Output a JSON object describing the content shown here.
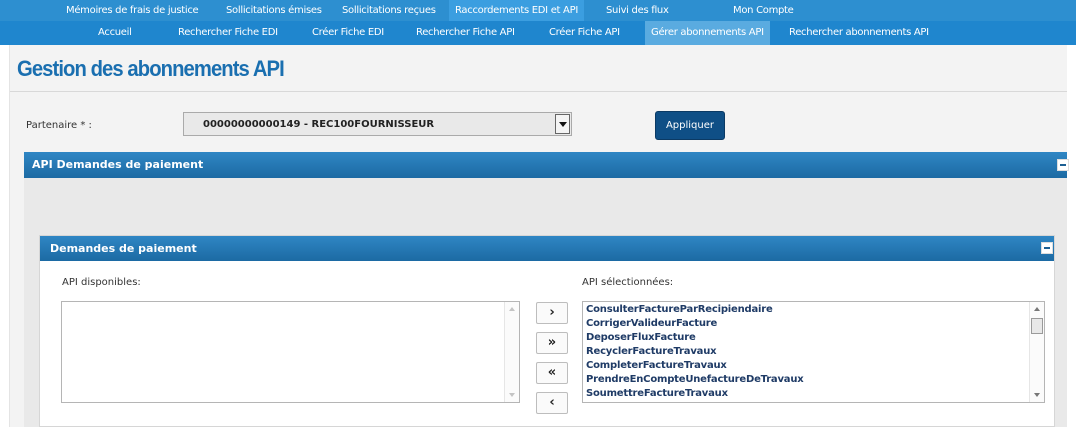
{
  "top_menu": [
    "Mémoires de frais de justice",
    "Sollicitations émises",
    "Sollicitations reçues",
    "Raccordements EDI et API",
    "Suivi des flux",
    "Mon Compte"
  ],
  "sub_menu": [
    "Accueil",
    "Rechercher Fiche EDI",
    "Créer Fiche EDI",
    "Rechercher Fiche API",
    "Créer Fiche API",
    "Gérer abonnements API",
    "Rechercher abonnements API"
  ],
  "page_title": "Gestion des abonnements API",
  "partner": {
    "label": "Partenaire * :",
    "value": "00000000000149 - REC100FOURNISSEUR"
  },
  "apply_label": "Appliquer",
  "section_main": {
    "title": "API Demandes de paiement"
  },
  "section_sub": {
    "title": "Demandes de paiement"
  },
  "available": {
    "label": "API disponibles:",
    "items": []
  },
  "selected": {
    "label": "API sélectionnées:",
    "items": [
      "ConsulterFactureParRecipiendaire",
      "CorrigerValideurFacture",
      "DeposerFluxFacture",
      "RecyclerFactureTravaux",
      "CompleterFactureTravaux",
      "PrendreEnCompteUnefactureDeTravaux",
      "SoumettreFactureTravaux"
    ]
  },
  "move_buttons": {
    "add": "›",
    "add_all": "»",
    "remove_all": "«",
    "remove": "‹"
  },
  "colors": {
    "nav_bar": "#2d8fd0",
    "nav_active": "#5aabe0",
    "title_blue": "#1a6fb0",
    "section_header": "#1c6aa3",
    "apply_button": "#0f4f86"
  }
}
